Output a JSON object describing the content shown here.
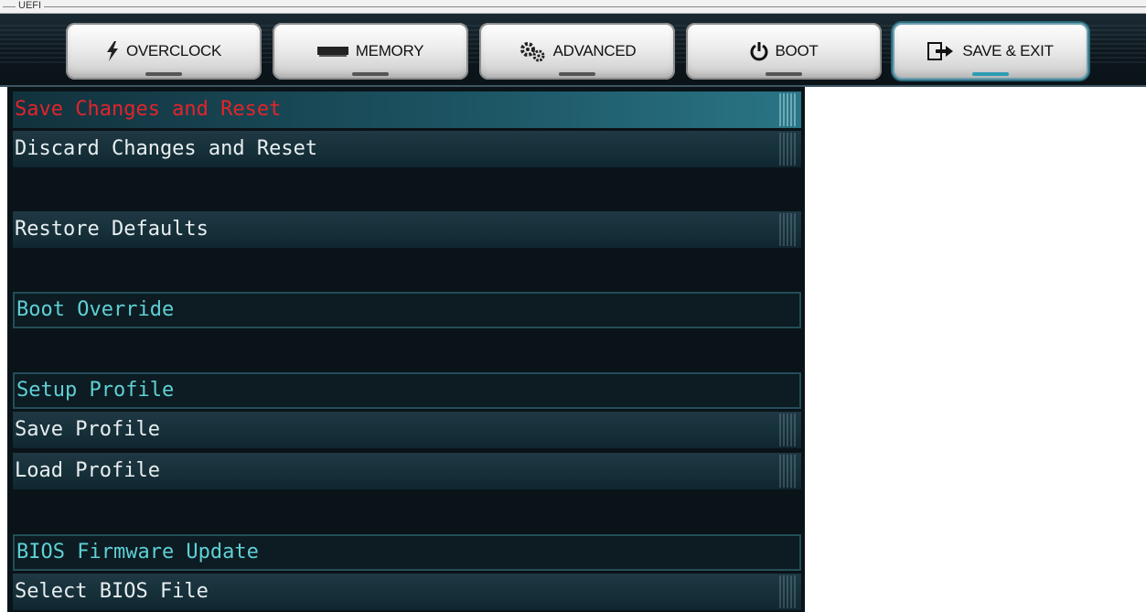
{
  "window": {
    "title": "UEFI"
  },
  "tabs": [
    {
      "label": "OVERCLOCK",
      "icon": "lightning-icon",
      "active": false
    },
    {
      "label": "MEMORY",
      "icon": "memory-module-icon",
      "active": false
    },
    {
      "label": "ADVANCED",
      "icon": "gears-icon",
      "active": false
    },
    {
      "label": "BOOT",
      "icon": "power-icon",
      "active": false
    },
    {
      "label": "SAVE & EXIT",
      "icon": "exit-arrow-icon",
      "active": true
    }
  ],
  "menu": {
    "save_changes_reset": "Save Changes and Reset",
    "discard_changes_reset": "Discard Changes and Reset",
    "restore_defaults": "Restore Defaults",
    "boot_override": "Boot Override",
    "setup_profile": "Setup Profile",
    "save_profile": "Save Profile",
    "load_profile": "Load Profile",
    "bios_firmware_update": "BIOS Firmware Update",
    "select_bios_file": "Select BIOS File"
  },
  "colors": {
    "selected_text": "#e3242b",
    "section_text": "#5fd0d6",
    "item_text": "#e8eef0",
    "panel_background": "#0a1318",
    "active_tab_accent": "#2e9cb3"
  }
}
